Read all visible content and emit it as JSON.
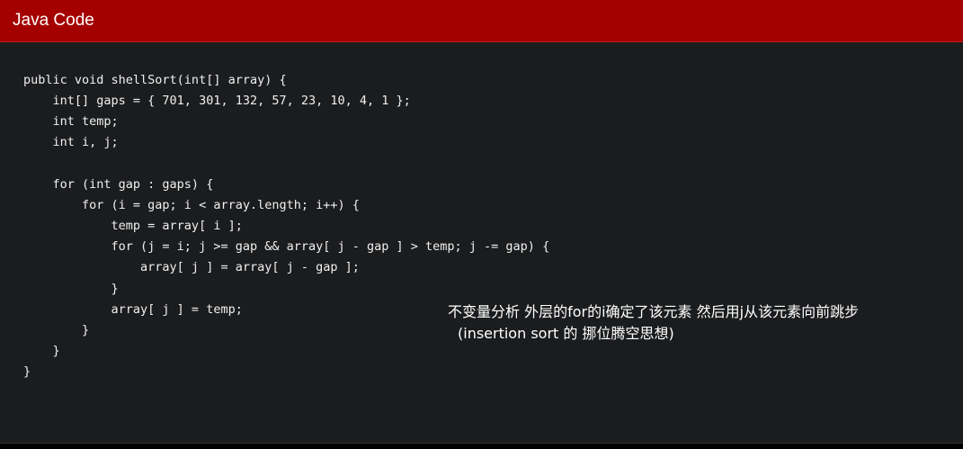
{
  "header": {
    "title": "Java Code"
  },
  "code": {
    "lines": [
      "public void shellSort(int[] array) {",
      "    int[] gaps = { 701, 301, 132, 57, 23, 10, 4, 1 };",
      "    int temp;",
      "    int i, j;",
      "",
      "    for (int gap : gaps) {",
      "        for (i = gap; i < array.length; i++) {",
      "            temp = array[ i ];",
      "            for (j = i; j >= gap && array[ j - gap ] > temp; j -= gap) {",
      "                array[ j ] = array[ j - gap ];",
      "            }",
      "            array[ j ] = temp;",
      "        }",
      "    }",
      "}"
    ]
  },
  "annotation": {
    "line1": "不变量分析 外层的for的i确定了该元素 然后用j从该元素向前跳步",
    "line2": "(insertion sort 的 挪位腾空思想)"
  },
  "colors": {
    "header_bg": "#a50000",
    "panel_bg": "#1b1c1e",
    "code_text": "#f0f0f0",
    "annotation_text": "#ffffff"
  }
}
